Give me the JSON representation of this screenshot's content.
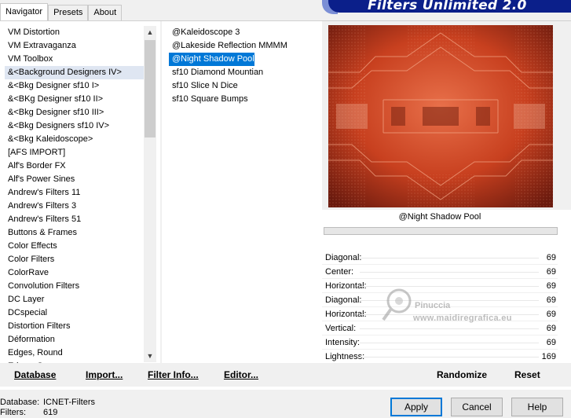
{
  "tabs": [
    {
      "label": "Navigator",
      "active": true
    },
    {
      "label": "Presets",
      "active": false
    },
    {
      "label": "About",
      "active": false
    }
  ],
  "brand": "Filters Unlimited 2.0",
  "categories": [
    "VM Distortion",
    "VM Extravaganza",
    "VM Toolbox",
    "&<Background Designers IV>",
    "&<Bkg Designer sf10 I>",
    "&<BKg Designer sf10 II>",
    "&<Bkg Designer sf10 III>",
    "&<Bkg Designers sf10 IV>",
    "&<Bkg Kaleidoscope>",
    "[AFS IMPORT]",
    "Alf's Border FX",
    "Alf's Power Sines",
    "Andrew's Filters 11",
    "Andrew's Filters 3",
    "Andrew's Filters 51",
    "Buttons & Frames",
    "Color Effects",
    "Color Filters",
    "ColorRave",
    "Convolution Filters",
    "DC Layer",
    "DCspecial",
    "Distortion Filters",
    "Déformation",
    "Edges, Round",
    "Edges, Square"
  ],
  "selected_category_index": 3,
  "filters": [
    "@Kaleidoscope 3",
    "@Lakeside Reflection MMMM",
    "@Night Shadow Pool",
    "sf10 Diamond Mountian",
    "sf10 Slice N Dice",
    "sf10 Square Bumps"
  ],
  "selected_filter_index": 2,
  "preview": {
    "filter_name": "@Night Shadow Pool",
    "colors": {
      "base": "#c8401f",
      "dark": "#6a1a0e",
      "light": "#e8704a"
    }
  },
  "params": [
    {
      "label": "Diagonal:",
      "value": "69"
    },
    {
      "label": "Center:",
      "value": "69"
    },
    {
      "label": "Horizontal:",
      "value": "69"
    },
    {
      "label": "Diagonal:",
      "value": "69"
    },
    {
      "label": "Horizontal:",
      "value": "69"
    },
    {
      "label": "Vertical:",
      "value": "69"
    },
    {
      "label": "Intensity:",
      "value": "69"
    },
    {
      "label": "Lightness:",
      "value": "169"
    }
  ],
  "watermark": {
    "line1": "Pinuccia",
    "line2": "www.maidiregrafica.eu"
  },
  "buttons": {
    "database": "Database",
    "import": "Import...",
    "filter_info": "Filter Info...",
    "editor": "Editor...",
    "randomize": "Randomize",
    "reset": "Reset",
    "apply": "Apply",
    "cancel": "Cancel",
    "help": "Help"
  },
  "footer": {
    "database_label": "Database:",
    "database_value": "ICNET-Filters",
    "filters_label": "Filters:",
    "filters_value": "619"
  }
}
